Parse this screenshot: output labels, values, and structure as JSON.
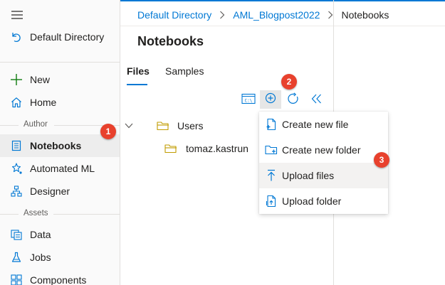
{
  "colors": {
    "accent": "#0078d4",
    "badge": "#e8412d",
    "folder": "#c19c00"
  },
  "sidebar": {
    "back_label": "Default Directory",
    "items": [
      {
        "label": "New",
        "icon": "plus-icon"
      },
      {
        "label": "Home",
        "icon": "home-icon"
      }
    ],
    "section_author": "Author",
    "author_items": [
      {
        "label": "Notebooks",
        "icon": "notebook-icon",
        "selected": true
      },
      {
        "label": "Automated ML",
        "icon": "automl-icon"
      },
      {
        "label": "Designer",
        "icon": "designer-icon"
      }
    ],
    "section_assets": "Assets",
    "asset_items": [
      {
        "label": "Data",
        "icon": "data-icon"
      },
      {
        "label": "Jobs",
        "icon": "flask-icon"
      },
      {
        "label": "Components",
        "icon": "components-icon"
      }
    ]
  },
  "breadcrumb": {
    "items": [
      "Default Directory",
      "AML_Blogpost2022",
      "Notebooks"
    ]
  },
  "panel": {
    "title": "Notebooks",
    "tabs": [
      {
        "label": "Files",
        "active": true
      },
      {
        "label": "Samples",
        "active": false
      }
    ]
  },
  "toolbar": {
    "buttons": [
      "terminal-icon",
      "add-circle-icon",
      "refresh-icon",
      "collapse-icon"
    ]
  },
  "tree": {
    "root": "Users",
    "child": "tomaz.kastrun"
  },
  "menu": {
    "items": [
      {
        "label": "Create new file",
        "icon": "new-file-icon"
      },
      {
        "label": "Create new folder",
        "icon": "new-folder-icon"
      },
      {
        "label": "Upload files",
        "icon": "upload-icon",
        "hover": true
      },
      {
        "label": "Upload folder",
        "icon": "upload-folder-icon"
      }
    ]
  },
  "badges": [
    "1",
    "2",
    "3"
  ]
}
